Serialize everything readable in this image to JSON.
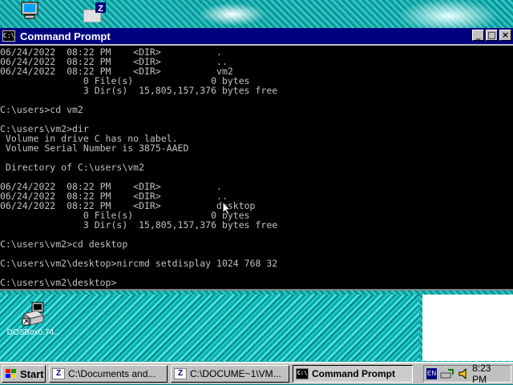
{
  "window": {
    "title": "Command Prompt",
    "icon_label": "C:\\",
    "minimize_glyph": "_",
    "maximize_glyph": "□",
    "close_glyph": "×"
  },
  "console": {
    "lines": [
      "06/24/2022  08:22 PM    <DIR>          .",
      "06/24/2022  08:22 PM    <DIR>          ..",
      "06/24/2022  08:22 PM    <DIR>          vm2",
      "               0 File(s)              0 bytes",
      "               3 Dir(s)  15,805,157,376 bytes free",
      "",
      "C:\\users>cd vm2",
      "",
      "C:\\users\\vm2>dir",
      " Volume in drive C has no label.",
      " Volume Serial Number is 3875-AAED",
      "",
      " Directory of C:\\users\\vm2",
      "",
      "06/24/2022  08:22 PM    <DIR>          .",
      "06/24/2022  08:22 PM    <DIR>          ..",
      "06/24/2022  08:22 PM    <DIR>          desktop",
      "               0 File(s)              0 bytes",
      "               3 Dir(s)  15,805,157,376 bytes free",
      "",
      "C:\\users\\vm2>cd desktop",
      "",
      "C:\\users\\vm2\\desktop>nircmd setdisplay 1024 768 32",
      "",
      "C:\\users\\vm2\\desktop>"
    ]
  },
  "desktop": {
    "shortcut_label": "DOSBox0.74...",
    "top_icons": [
      "computer-icon",
      "zip-icon"
    ]
  },
  "taskbar": {
    "start_label": "Start",
    "buttons": [
      {
        "label": "C:\\Documents and...",
        "icon": "z"
      },
      {
        "label": "C:\\DOCUME~1\\VM...",
        "icon": "z"
      },
      {
        "label": "Command Prompt",
        "icon": "cmd"
      }
    ],
    "tray": {
      "lang": "EN",
      "clock": "8:23 PM"
    }
  },
  "colors": {
    "titlebar": "#000080",
    "console_bg": "#000000",
    "console_fg": "#c0c0c0",
    "desktop": "#008080"
  }
}
